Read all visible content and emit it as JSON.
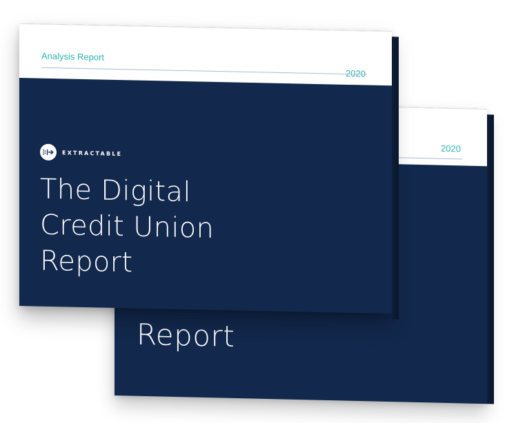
{
  "back_cover": {
    "year": "2020",
    "title_visible": "Report"
  },
  "front_cover": {
    "label": "Analysis Report",
    "year": "2020",
    "brand": "EXTRACTABLE",
    "title_lines": [
      "The Digital",
      "Credit Union",
      "Report"
    ]
  },
  "colors": {
    "cover_navy": "#12284c",
    "accent_teal": "#2db3b0",
    "rule_blue": "#a7bcd3"
  },
  "icons": {
    "brand_logo": "extractable-logo-icon"
  }
}
